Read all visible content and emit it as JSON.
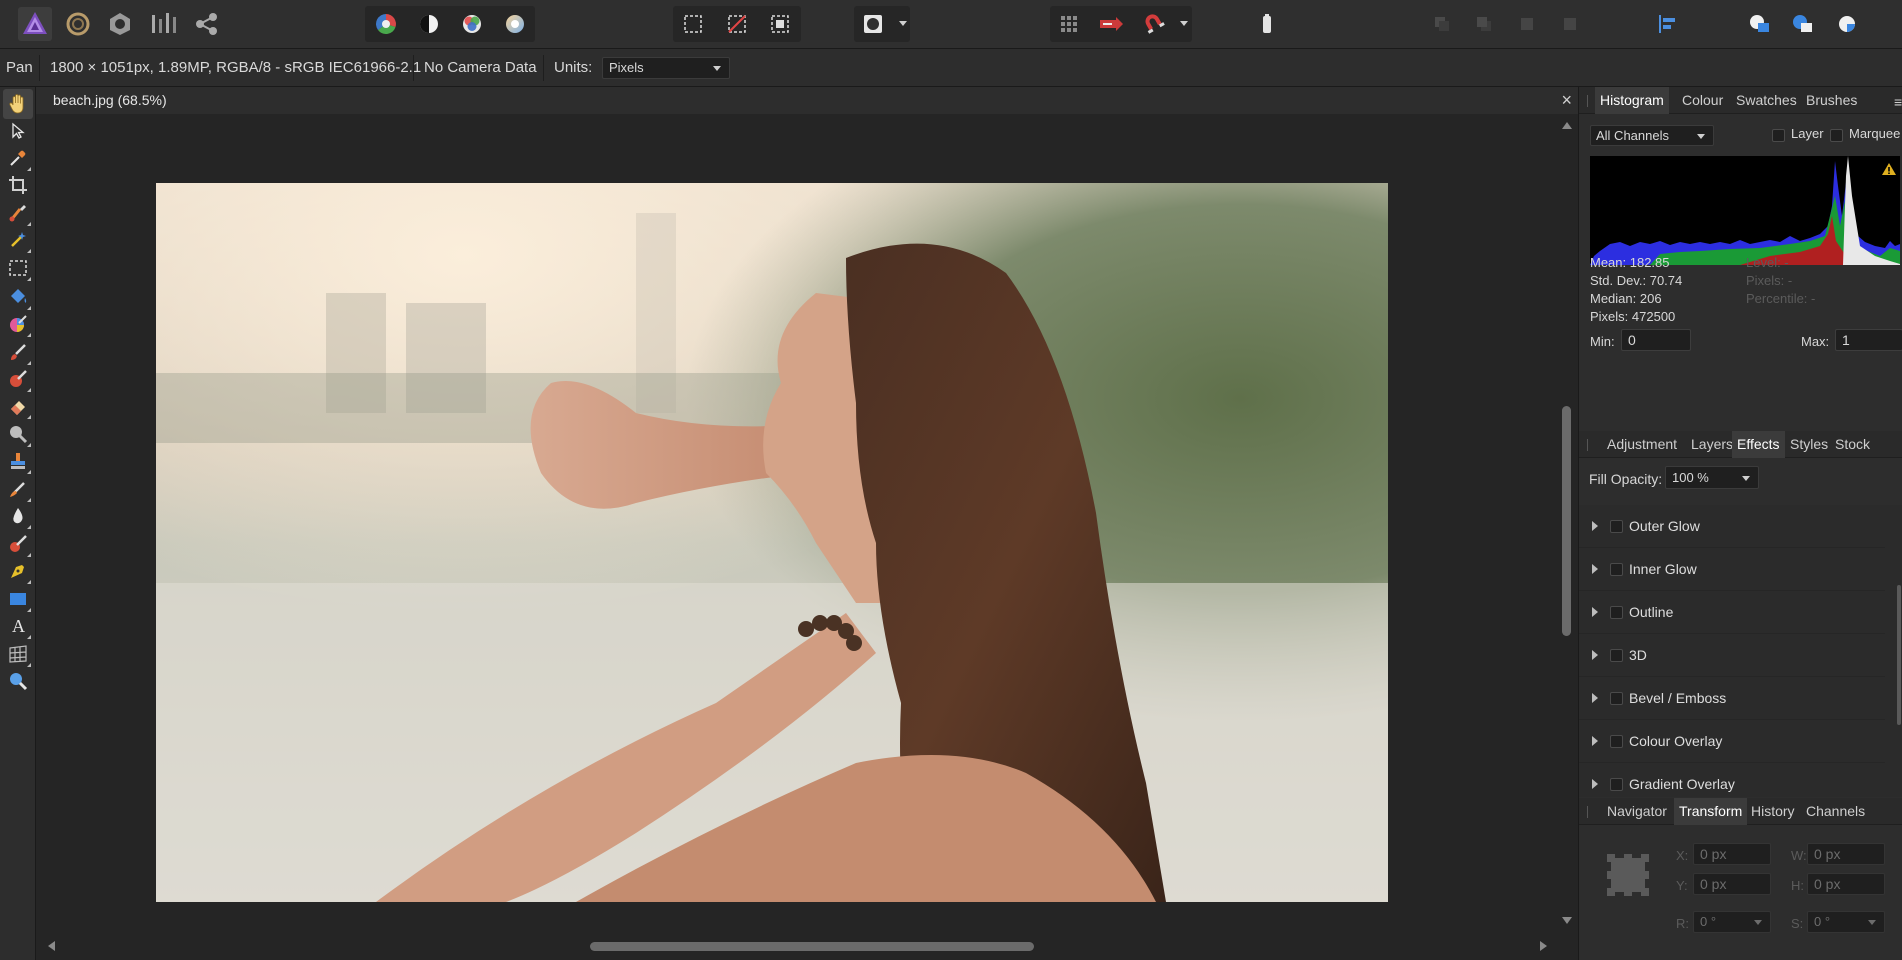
{
  "toolbar": {
    "personas": [
      "photo-persona",
      "liquify-persona",
      "develop-persona",
      "tone-mapping-persona",
      "export-persona"
    ],
    "adjust_tools": [
      "auto-levels",
      "auto-contrast",
      "auto-colour",
      "auto-white-balance"
    ],
    "selection_tools": [
      "select-all",
      "deselect",
      "invert-pixel-selection"
    ],
    "mask_tools": [
      "quick-mask"
    ],
    "snapping_tools": [
      "grid",
      "force-pixel-alignment",
      "snapping"
    ],
    "arrange_tools": [
      "move-back-one",
      "move-forward-one",
      "move-to-back",
      "move-to-front"
    ],
    "align_tools": [
      "align-left"
    ],
    "boolean_tools": [
      "add",
      "subtract",
      "intersect"
    ]
  },
  "context": {
    "tool_name": "Pan",
    "doc_info": "1800 × 1051px, 1.89MP, RGBA/8 - sRGB IEC61966-2.1",
    "camera": "No Camera Data",
    "units_label": "Units:",
    "units_value": "Pixels"
  },
  "tools": [
    "hand",
    "move",
    "colour-picker",
    "crop",
    "brush-selection",
    "selection-brush",
    "marquee",
    "flood-fill",
    "colour-brush",
    "paint-brush",
    "paint-mixer",
    "erase",
    "dodge",
    "clone",
    "smudge",
    "blur",
    "sponge",
    "pen",
    "rectangle",
    "text",
    "mesh-warp",
    "zoom"
  ],
  "document": {
    "title": "beach.jpg (68.5%)",
    "close": "×"
  },
  "histogram_panel": {
    "tabs": [
      "Histogram",
      "Colour",
      "Swatches",
      "Brushes"
    ],
    "active_tab": "Histogram",
    "channels": "All Channels",
    "layer_label": "Layer",
    "marquee_label": "Marquee",
    "stats": {
      "mean": "Mean: 182.85",
      "std_dev": "Std. Dev.: 70.74",
      "median": "Median: 206",
      "pixels": "Pixels: 472500",
      "level": "Level: -",
      "pixels_sel": "Pixels: -",
      "percentile": "Percentile: -"
    },
    "min_label": "Min:",
    "min_value": "0",
    "max_label": "Max:",
    "max_value": "1"
  },
  "effects_panel": {
    "tabs": [
      "Adjustment",
      "Layers",
      "Effects",
      "Styles",
      "Stock"
    ],
    "active_tab": "Effects",
    "fill_opacity_label": "Fill Opacity:",
    "fill_opacity_value": "100 %",
    "effects": [
      "Outer Glow",
      "Inner Glow",
      "Outline",
      "3D",
      "Bevel / Emboss",
      "Colour Overlay",
      "Gradient Overlay"
    ]
  },
  "transform_panel": {
    "tabs": [
      "Navigator",
      "Transform",
      "History",
      "Channels"
    ],
    "active_tab": "Transform",
    "x_label": "X:",
    "x_value": "0 px",
    "y_label": "Y:",
    "y_value": "0 px",
    "w_label": "W:",
    "w_value": "0 px",
    "h_label": "H:",
    "h_value": "0 px",
    "r_label": "R:",
    "r_value": "0 °",
    "s_label": "S:",
    "s_value": "0 °"
  },
  "colors": {
    "accent": "#3a6ea5",
    "warning": "#e0b020"
  }
}
